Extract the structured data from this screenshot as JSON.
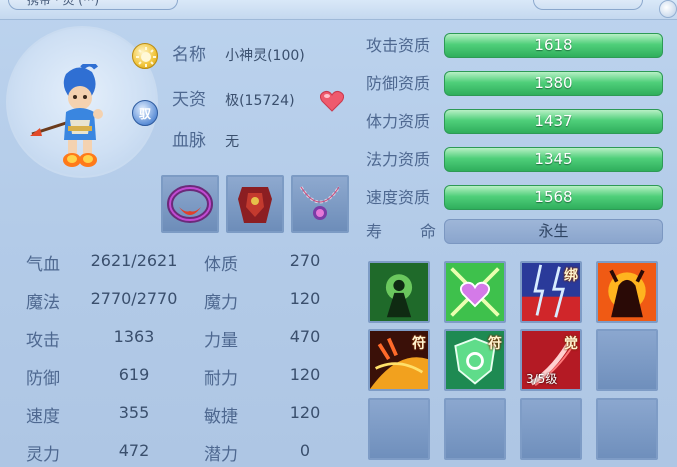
{
  "header": {
    "left_tab_text": "携带 · 灵 (···)",
    "right_tab_text": ""
  },
  "pet": {
    "badge_sun_icon": "sun-icon",
    "badge_yu_text": "驭",
    "name_label": "名称",
    "name_value": "小神灵(100)",
    "talent_label": "天资",
    "talent_value": "极(15724)",
    "bloodline_label": "血脉",
    "bloodline_value": "无"
  },
  "equipment": [
    {
      "name": "collar-equipment",
      "icon": "collar-icon"
    },
    {
      "name": "armor-equipment",
      "icon": "armor-icon"
    },
    {
      "name": "necklace-equipment",
      "icon": "necklace-icon"
    }
  ],
  "stats_left": [
    {
      "label": "气血",
      "value": "2621/2621"
    },
    {
      "label": "魔法",
      "value": "2770/2770"
    },
    {
      "label": "攻击",
      "value": "1363"
    },
    {
      "label": "防御",
      "value": "619"
    },
    {
      "label": "速度",
      "value": "355"
    },
    {
      "label": "灵力",
      "value": "472"
    }
  ],
  "stats_right": [
    {
      "label": "体质",
      "value": "270"
    },
    {
      "label": "魔力",
      "value": "120"
    },
    {
      "label": "力量",
      "value": "470"
    },
    {
      "label": "耐力",
      "value": "120"
    },
    {
      "label": "敏捷",
      "value": "120"
    },
    {
      "label": "潜力",
      "value": "0"
    }
  ],
  "aptitudes": [
    {
      "label": "攻击资质",
      "value": "1618"
    },
    {
      "label": "防御资质",
      "value": "1380"
    },
    {
      "label": "体力资质",
      "value": "1437"
    },
    {
      "label": "法力资质",
      "value": "1345"
    },
    {
      "label": "速度资质",
      "value": "1568"
    }
  ],
  "life": {
    "label_1": "寿",
    "label_2": "命",
    "value": "永生"
  },
  "skills": [
    {
      "icon": "shadow-warrior-icon",
      "tag": "",
      "level": ""
    },
    {
      "icon": "heart-shield-icon",
      "tag": "",
      "level": ""
    },
    {
      "icon": "lightning-storm-icon",
      "tag": "绑",
      "level": ""
    },
    {
      "icon": "demon-rage-icon",
      "tag": "",
      "level": ""
    },
    {
      "icon": "fire-claw-icon",
      "tag": "符",
      "level": ""
    },
    {
      "icon": "green-shield-icon",
      "tag": "符",
      "level": ""
    },
    {
      "icon": "crimson-slash-icon",
      "tag": "觉",
      "level": "3/5级"
    },
    {
      "icon": "empty-slot",
      "tag": "",
      "level": ""
    },
    {
      "icon": "empty-slot",
      "tag": "",
      "level": ""
    },
    {
      "icon": "empty-slot",
      "tag": "",
      "level": ""
    },
    {
      "icon": "empty-slot",
      "tag": "",
      "level": ""
    },
    {
      "icon": "empty-slot",
      "tag": "",
      "level": ""
    }
  ],
  "colors": {
    "label": "#4e6890",
    "value": "#3a4f6d",
    "aptitude_bar": "#3fbf6a",
    "life_bar": "#8aa5cd"
  }
}
